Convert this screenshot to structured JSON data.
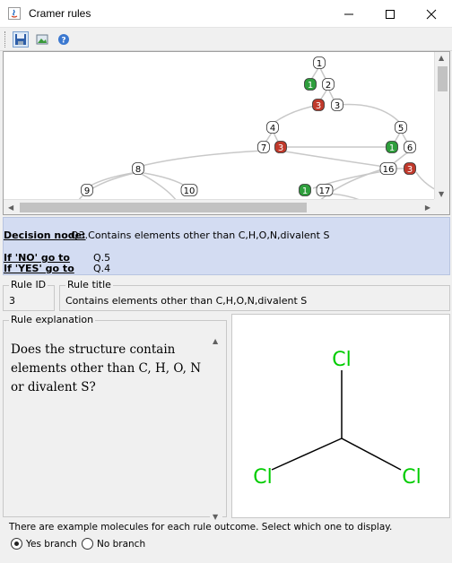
{
  "window": {
    "title": "Cramer rules",
    "minimize_glyph": "—",
    "maximize_glyph": "☐",
    "close_glyph": "✕"
  },
  "toolbar": {
    "buttons": [
      {
        "icon": "save-icon"
      },
      {
        "icon": "image-icon"
      },
      {
        "icon": "help-icon"
      }
    ]
  },
  "tree": {
    "nodes": [
      {
        "label": "1",
        "color": "white"
      },
      {
        "label": "1",
        "color": "green"
      },
      {
        "label": "2",
        "color": "white"
      },
      {
        "label": "3",
        "color": "red"
      },
      {
        "label": "3",
        "color": "white"
      },
      {
        "label": "4",
        "color": "white"
      },
      {
        "label": "5",
        "color": "white"
      },
      {
        "label": "7",
        "color": "white"
      },
      {
        "label": "3",
        "color": "red"
      },
      {
        "label": "1",
        "color": "green"
      },
      {
        "label": "6",
        "color": "white"
      },
      {
        "label": "8",
        "color": "white"
      },
      {
        "label": "16",
        "color": "white"
      },
      {
        "label": "3",
        "color": "red"
      },
      {
        "label": "9",
        "color": "white"
      },
      {
        "label": "10",
        "color": "white"
      },
      {
        "label": "1",
        "color": "green"
      },
      {
        "label": "17",
        "color": "white"
      }
    ],
    "colors": {
      "green": "#2e9e3c",
      "red": "#c0392b",
      "white": "#ffffff"
    }
  },
  "decision": {
    "node_label": "Decision node:",
    "node_value": "Q3.Contains elements other than C,H,O,N,divalent S",
    "no_label": "If 'NO' go to",
    "no_value": "Q.5",
    "yes_label": "If 'YES' go to",
    "yes_value": "Q.4"
  },
  "rule": {
    "id_label": "Rule ID",
    "id_value": "3",
    "title_label": "Rule title",
    "title_value": "Contains elements other than C,H,O,N,divalent S",
    "explanation_label": "Rule explanation",
    "explanation_text": "Does the structure contain elements other than C, H, O, N or divalent S?"
  },
  "molecule": {
    "atoms": [
      "Cl",
      "Cl",
      "Cl"
    ],
    "atom_color": "#00cc00"
  },
  "bottom": {
    "info_text": "There are example molecules for each rule outcome. Select which one to display.",
    "yes_branch": "Yes branch",
    "no_branch": "No branch",
    "selected": "Yes branch"
  }
}
